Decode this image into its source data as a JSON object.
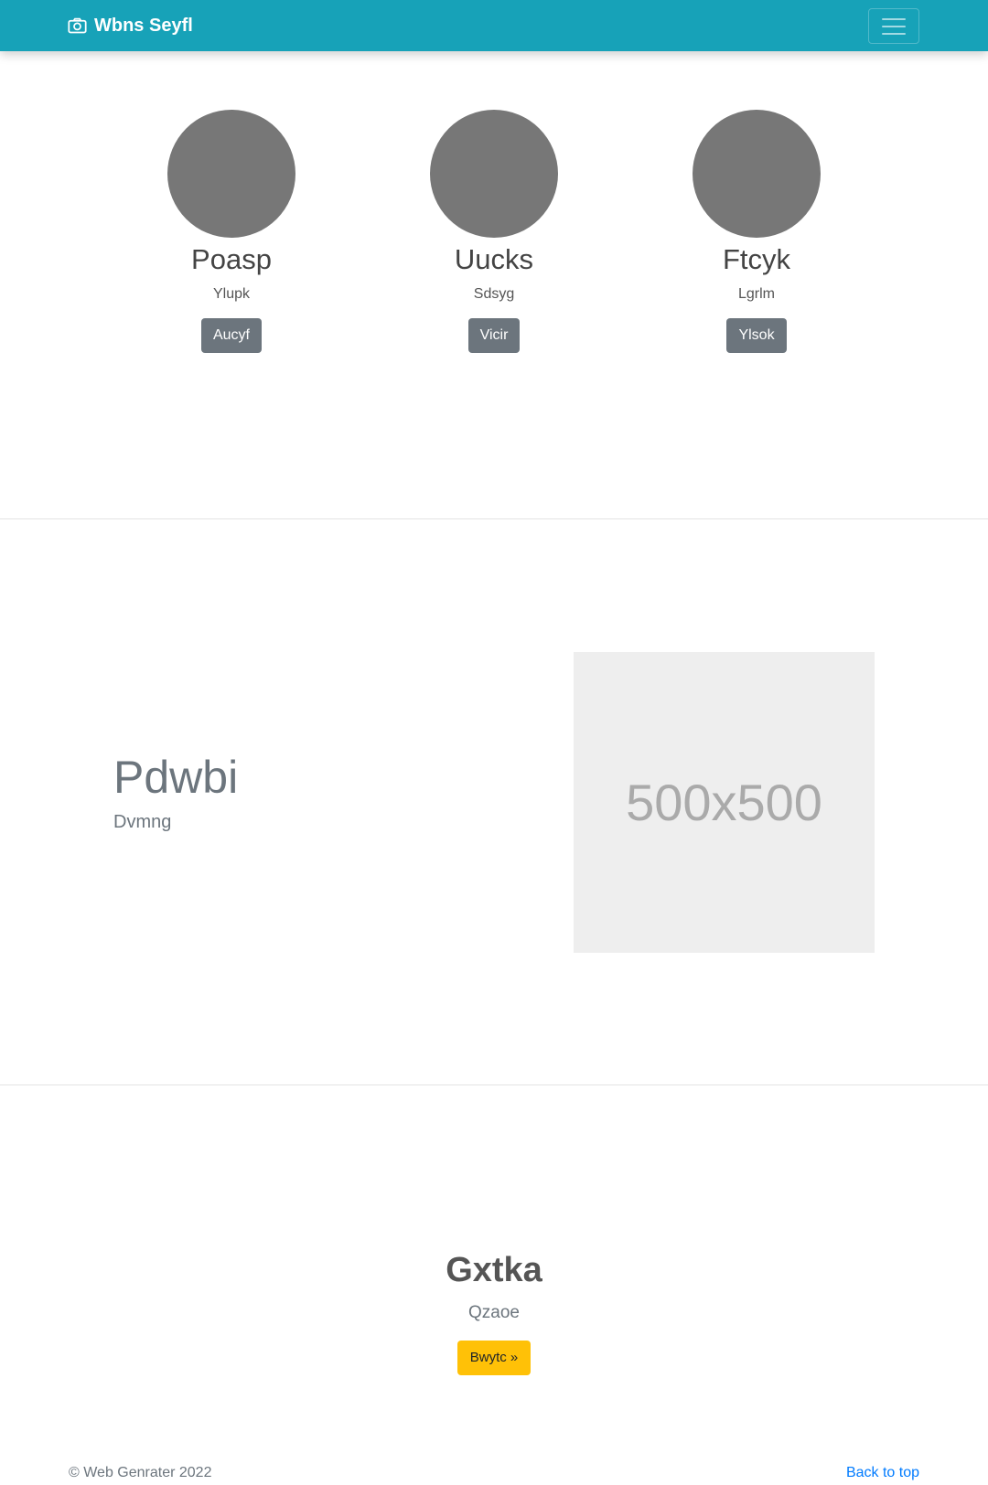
{
  "navbar": {
    "brand": "Wbns Seyfl",
    "brand_icon": "camera-icon",
    "toggler_icon": "hamburger-menu-icon",
    "color": "#17a2b8"
  },
  "team": [
    {
      "name": "Poasp",
      "role": "Ylupk",
      "button": "Aucyf"
    },
    {
      "name": "Uucks",
      "role": "Sdsyg",
      "button": "Vicir"
    },
    {
      "name": "Ftcyk",
      "role": "Lgrlm",
      "button": "Ylsok"
    }
  ],
  "feature": {
    "title": "Pdwbi",
    "subtitle": "Dvmng",
    "image_placeholder": "500x500"
  },
  "cta": {
    "title": "Gxtka",
    "subtitle": "Qzaoe",
    "button": "Bwytc »",
    "button_color": "#ffc107"
  },
  "footer": {
    "copyright": "© Web Genrater 2022",
    "back_to_top": "Back to top"
  }
}
